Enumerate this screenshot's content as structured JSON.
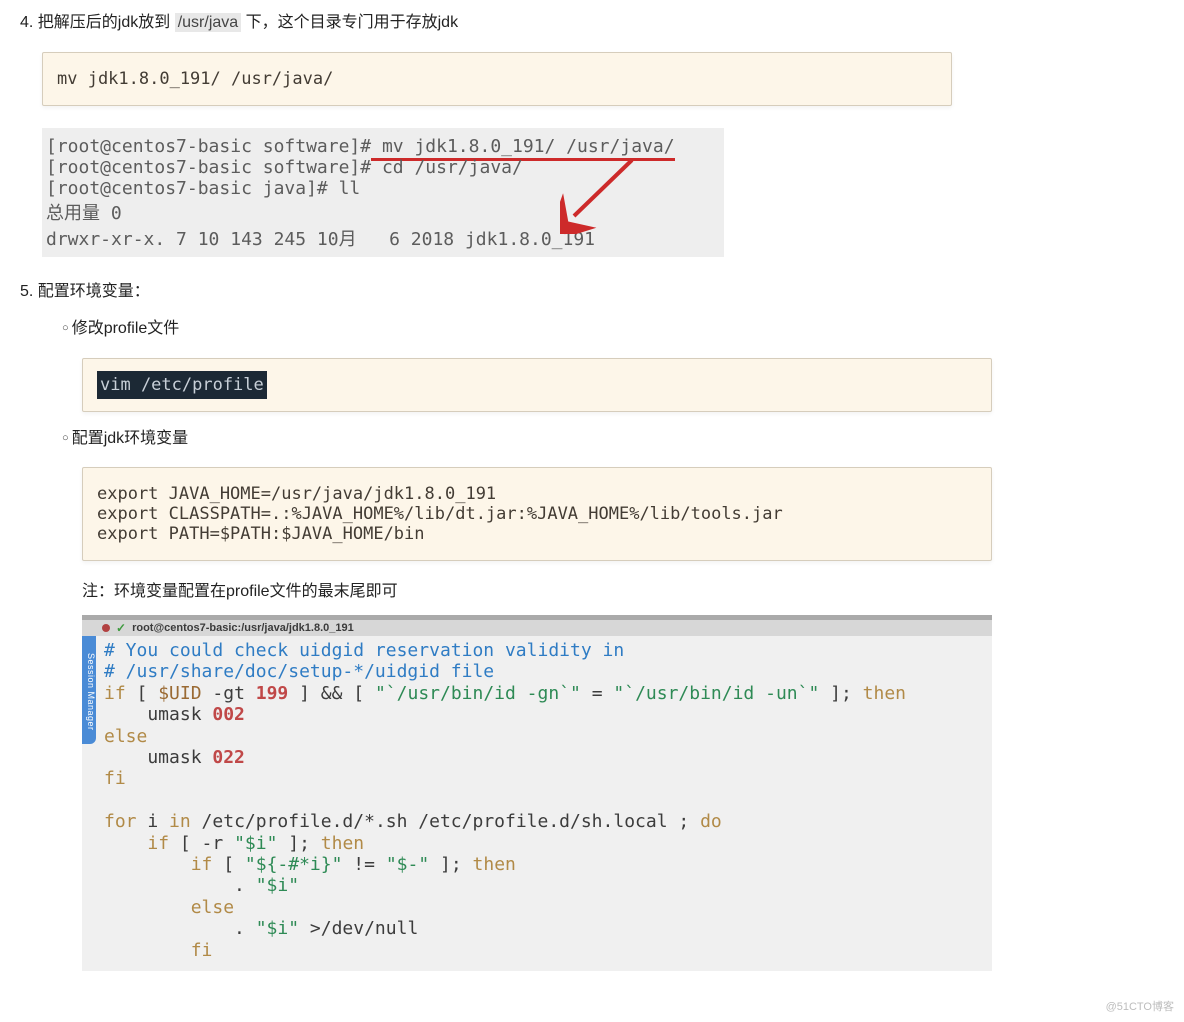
{
  "step4": {
    "num": "4",
    "text_before": "把解压后的jdk放到 ",
    "path": "/usr/java",
    "text_after": " 下，这个目录专门用于存放jdk",
    "code": "mv jdk1.8.0_191/ /usr/java/",
    "term": {
      "l1a": "[root@centos7-basic software]#",
      "l1b": " mv jdk1.8.0_191/ /usr/java/",
      "l2": "[root@centos7-basic software]# cd /usr/java/",
      "l3": "[root@centos7-basic java]# ll",
      "l4": "总用量 0",
      "l5": "drwxr-xr-x. 7 10 143 245 10月   6 2018 jdk1.8.0_191"
    }
  },
  "step5": {
    "num": "5",
    "title": "配置环境变量：",
    "sub1": {
      "title": "修改profile文件",
      "code": "vim /etc/profile"
    },
    "sub2": {
      "title": "配置jdk环境变量",
      "code": "export JAVA_HOME=/usr/java/jdk1.8.0_191\nexport CLASSPATH=.:%JAVA_HOME%/lib/dt.jar:%JAVA_HOME%/lib/tools.jar\nexport PATH=$PATH:$JAVA_HOME/bin",
      "note": "注：环境变量配置在profile文件的最末尾即可"
    },
    "editor": {
      "tab_title": "root@centos7-basic:/usr/java/jdk1.8.0_191",
      "session_mgr": "Session Manager",
      "c1": "# You could check uidgid reservation validity in",
      "c2": "# /usr/share/doc/setup-*/uidgid file",
      "kw_if": "if",
      "var_uid": "$UID",
      "txt_gt": " -gt ",
      "num_199": "199",
      "txt_br1": " ] && [ ",
      "str1": "\"`/usr/bin/id -gn`\"",
      "txt_eq": " = ",
      "str2": "\"`/usr/bin/id -un`\"",
      "txt_br2": " ]; ",
      "kw_then": "then",
      "txt_umask": "    umask ",
      "num_002": "002",
      "kw_else": "else",
      "num_022": "022",
      "kw_fi": "fi",
      "kw_for": "for",
      "txt_for1": " i ",
      "kw_in": "in",
      "txt_for2": " /etc/profile.d/*.sh /etc/profile.d/sh.local ; ",
      "kw_do": "do",
      "txt_if2a": "    ",
      "txt_if2b": " [ -r ",
      "str_i": "\"$i\"",
      "txt_if2c": " ]; ",
      "txt_if3a": "        ",
      "txt_if3b": " [ ",
      "str_hash": "\"${-#*i}\"",
      "txt_if3c": " != ",
      "str_dash": "\"$-\"",
      "txt_if3d": " ]; ",
      "txt_dot": "            . ",
      "txt_else2": "        ",
      "txt_dot2a": "            . ",
      "txt_dot2b": " >/dev/null",
      "txt_fi2": "        "
    }
  },
  "watermark": "@51CTO博客"
}
